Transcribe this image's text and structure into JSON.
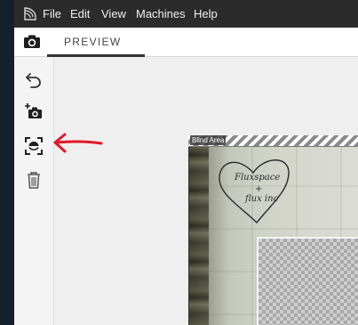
{
  "menu": {
    "items": [
      "File",
      "Edit",
      "View",
      "Machines",
      "Help"
    ]
  },
  "tabs": {
    "preview_label": "PREVIEW"
  },
  "canvas": {
    "blind_area_label": "Blind Area",
    "heart_text_line1": "Fluxspace",
    "heart_text_line2": "+",
    "heart_text_line3": "flux inc"
  },
  "colors": {
    "annotation": "#e0192a",
    "menubar": "#2b2b2b"
  }
}
